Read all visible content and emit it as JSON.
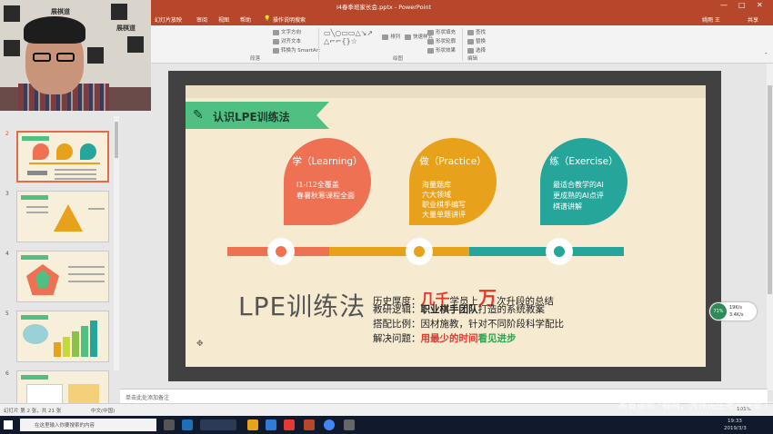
{
  "window": {
    "title": "I4春季班家长会.pptx  -  PowerPoint",
    "minimize": "—",
    "maximize": "□",
    "close": "✕"
  },
  "menu": {
    "tabs": [
      "幻灯片放映",
      "审阅",
      "视图",
      "帮助",
      "操作说明搜索"
    ],
    "user": "姚雨 王",
    "share": "共享"
  },
  "ribbon": {
    "groups": [
      "段落",
      "绘图",
      "编辑"
    ],
    "items": {
      "text_direction": "文字方向",
      "align_text": "对齐文本",
      "smartart": "转换为 SmartArt",
      "arrange": "排列",
      "quick_styles": "快速样式",
      "shape_fill": "形状填充",
      "shape_outline": "形状轮廓",
      "shape_effects": "形状效果",
      "find": "查找",
      "replace": "替换",
      "select": "选择"
    }
  },
  "webcam": {
    "logo_text": "展棋道"
  },
  "thumbnails": {
    "numbers": [
      "2",
      "3",
      "4",
      "5",
      "6"
    ],
    "active_index": 0
  },
  "slide": {
    "banner": "认识LPE训练法",
    "bubbles": [
      {
        "head": "学（Learning）",
        "lines": [
          "I1-I12全覆盖",
          "春暑秋寒课程全面"
        ],
        "color": "#ef7153"
      },
      {
        "head": "做（Practice）",
        "lines": [
          "海量题库",
          "六大领域",
          "职业棋手编写",
          "大量单题讲评"
        ],
        "color": "#e8a11a"
      },
      {
        "head": "练（Exercise）",
        "lines": [
          "最适合教学的AI",
          "更成熟的AI点评",
          "棋谱讲解"
        ],
        "color": "#26a69a"
      }
    ],
    "lpe_title": "LPE训练法",
    "info": {
      "row1_label": "历史厚度：",
      "row1_big": "几千",
      "row1_mid": "学员上",
      "row1_huge": "万",
      "row1_tail": "次升段的总结",
      "row2_label": "教研逻辑：",
      "row2_bold": "职业棋手团队",
      "row2_tail": "打造的系统教案",
      "row3_label": "搭配比例：",
      "row3_text": "因材施教，针对不同阶段科学配比",
      "row4_label": "解决问题：",
      "row4_red": "用最少的时间",
      "row4_green": "看见进步"
    }
  },
  "widget": {
    "percent": "71%",
    "up": "19K/s",
    "down": "3.4K/s"
  },
  "notes": {
    "placeholder": "单击此处添加备注"
  },
  "status": {
    "slide_info": "幻灯片 第 2 张，共 21 张",
    "language": "中文(中国)",
    "zoom": "103%"
  },
  "taskbar": {
    "search_placeholder": "在这里输入你要搜索的内容",
    "time": "19:33",
    "date": "2019/3/3"
  },
  "watermark": "奥普搜索  \"看啊，大伟先生考神课堂   广告\""
}
